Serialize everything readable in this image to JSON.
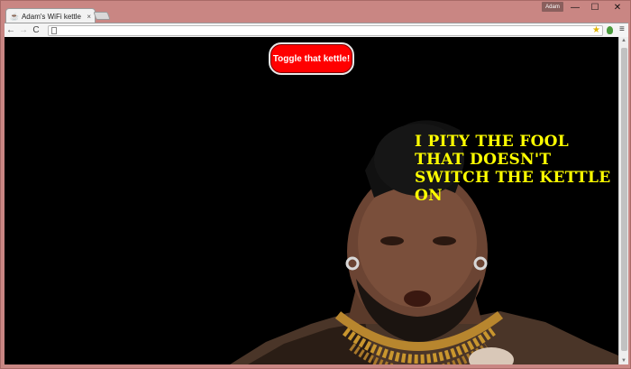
{
  "window": {
    "tab_title": "Adam's WiFi kettle",
    "tab_close": "×",
    "profile_name": "Adam",
    "minimize": "—",
    "maximize": "☐",
    "close": "✕"
  },
  "toolbar": {
    "back": "←",
    "forward": "→",
    "reload": "C",
    "url": "",
    "star": "★",
    "menu": "≡"
  },
  "page": {
    "toggle_button": "Toggle that kettle!",
    "quote": "I PITY THE FOOL THAT DOESN'T SWITCH THE KETTLE ON"
  },
  "colors": {
    "button_red": "#ff0000",
    "quote_yellow": "#ffff00",
    "page_background": "#000000",
    "window_frame": "#c98683"
  },
  "icons": [
    "kettle-favicon-icon",
    "back-icon",
    "forward-icon",
    "reload-icon",
    "page-icon",
    "star-icon",
    "extension-icon",
    "menu-icon"
  ]
}
